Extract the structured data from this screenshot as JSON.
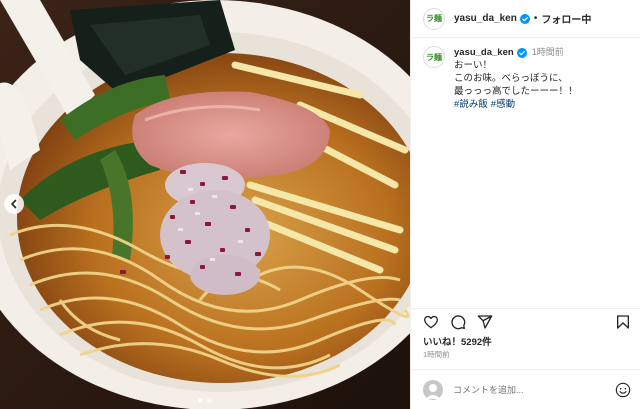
{
  "post": {
    "username": "yasu_da_ken",
    "follow_label": "フォロー中",
    "avatar_text": "ラ麺",
    "caption_time": "1時間前",
    "caption_lines": [
      "おーい！",
      "このお味。べらっぼうに、",
      "最っっっ高でしたーーー！！"
    ],
    "hashtags": [
      "#説み飯",
      "#感動"
    ],
    "likes": "いいね！5292件",
    "post_time": "1時間前",
    "comment_placeholder": "コメントを追加...",
    "carousel": {
      "total": 2,
      "active": 1
    }
  },
  "icons": [
    "chevron-left-icon",
    "verified-badge-icon",
    "heart-icon",
    "comment-icon",
    "share-icon",
    "bookmark-icon",
    "emoji-icon"
  ],
  "colors": {
    "accent_blue": "#0095f6",
    "hashtag": "#00376b",
    "muted": "#8e8e8e"
  }
}
